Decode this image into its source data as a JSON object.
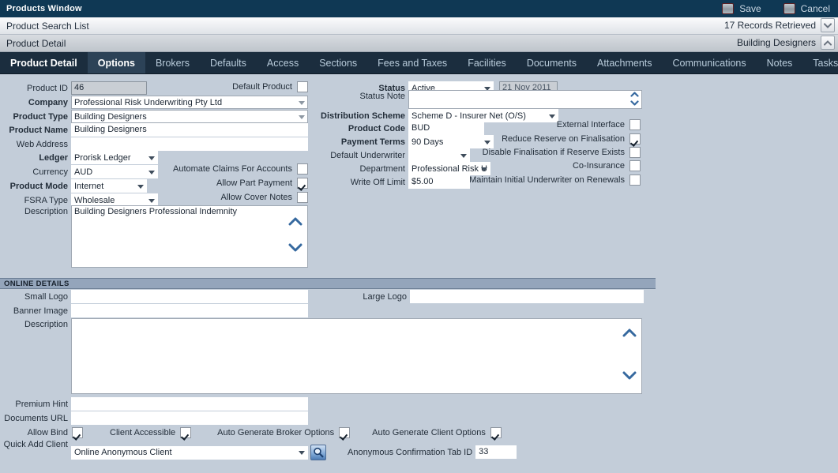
{
  "window": {
    "title": "Products Window",
    "actions": [
      {
        "name": "save",
        "label": "Save",
        "icon": "save-icon"
      },
      {
        "name": "cancel",
        "label": "Cancel",
        "icon": "cancel-icon"
      }
    ]
  },
  "search_bar": {
    "label": "Product Search List",
    "records_retrieved": "17 Records Retrieved",
    "collapse_icon": "chevron-down-icon"
  },
  "detail_bar": {
    "label": "Product Detail",
    "context": "Building Designers",
    "expand_icon": "chevron-up-icon"
  },
  "tabs": [
    {
      "label": "Product Detail",
      "state": "active"
    },
    {
      "label": "Options",
      "state": "current"
    },
    {
      "label": "Brokers",
      "state": "normal"
    },
    {
      "label": "Defaults",
      "state": "normal"
    },
    {
      "label": "Access",
      "state": "normal"
    },
    {
      "label": "Sections",
      "state": "normal"
    },
    {
      "label": "Fees and Taxes",
      "state": "normal"
    },
    {
      "label": "Facilities",
      "state": "normal"
    },
    {
      "label": "Documents",
      "state": "normal"
    },
    {
      "label": "Attachments",
      "state": "normal"
    },
    {
      "label": "Communications",
      "state": "normal"
    },
    {
      "label": "Notes",
      "state": "normal"
    },
    {
      "label": "Tasks",
      "state": "normal"
    }
  ],
  "product_detail": {
    "product_id": {
      "label": "Product ID",
      "value": "46"
    },
    "default_product": {
      "label": "Default Product",
      "checked": false
    },
    "company": {
      "label": "Company",
      "value": "Professional Risk Underwriting Pty Ltd"
    },
    "product_type": {
      "label": "Product Type",
      "value": "Building Designers"
    },
    "product_name": {
      "label": "Product Name",
      "value": "Building Designers"
    },
    "web_address": {
      "label": "Web Address",
      "value": ""
    },
    "ledger": {
      "label": "Ledger",
      "value": "Prorisk Ledger"
    },
    "currency": {
      "label": "Currency",
      "value": "AUD"
    },
    "product_mode": {
      "label": "Product Mode",
      "value": "Internet"
    },
    "fsra_type": {
      "label": "FSRA Type",
      "value": "Wholesale"
    },
    "description": {
      "label": "Description",
      "value": "Building Designers Professional Indemnity"
    },
    "automate_claims": {
      "label": "Automate Claims For Accounts",
      "checked": false
    },
    "allow_part_payment": {
      "label": "Allow Part Payment",
      "checked": true
    },
    "allow_cover_notes": {
      "label": "Allow Cover Notes",
      "checked": false
    },
    "status": {
      "label": "Status",
      "value": "Active"
    },
    "status_date": {
      "value": "21 Nov 2011"
    },
    "status_note": {
      "label": "Status Note",
      "value": ""
    },
    "distribution_scheme": {
      "label": "Distribution Scheme",
      "value": "Scheme D - Insurer Net (O/S)"
    },
    "product_code": {
      "label": "Product Code",
      "value": "BUD"
    },
    "payment_terms": {
      "label": "Payment Terms",
      "value": "90 Days"
    },
    "default_underwriter": {
      "label": "Default Underwriter",
      "value": ""
    },
    "department": {
      "label": "Department",
      "value": "Professional Risk U"
    },
    "write_off_limit": {
      "label": "Write Off Limit",
      "value": "$5.00"
    },
    "external_interface": {
      "label": "External Interface",
      "checked": false
    },
    "reduce_reserve": {
      "label": "Reduce Reserve on Finalisation",
      "checked": true
    },
    "disable_finalisation": {
      "label": "Disable Finalisation if Reserve Exists",
      "checked": false
    },
    "co_insurance": {
      "label": "Co-Insurance",
      "checked": false
    },
    "maintain_initial_underwriter": {
      "label": "Maintain Initial Underwriter on Renewals",
      "checked": false
    }
  },
  "online_details": {
    "header": "ONLINE DETAILS",
    "small_logo": {
      "label": "Small Logo",
      "value": ""
    },
    "large_logo": {
      "label": "Large Logo",
      "value": ""
    },
    "banner_image": {
      "label": "Banner Image",
      "value": ""
    },
    "description": {
      "label": "Description",
      "value": ""
    },
    "premium_hint": {
      "label": "Premium Hint",
      "value": ""
    },
    "documents_url": {
      "label": "Documents URL",
      "value": ""
    },
    "allow_bind": {
      "label": "Allow Bind",
      "checked": true
    },
    "client_accessible": {
      "label": "Client Accessible",
      "checked": true
    },
    "auto_generate_broker_options": {
      "label": "Auto Generate Broker Options",
      "checked": true
    },
    "auto_generate_client_options": {
      "label": "Auto Generate Client Options",
      "checked": true
    },
    "quick_add_client": {
      "label": "Quick Add Client",
      "value": "Online Anonymous Client",
      "search_icon": "magnifier-icon"
    },
    "anonymous_confirmation_tab_id": {
      "label": "Anonymous Confirmation Tab ID",
      "value": "33"
    }
  },
  "colors": {
    "titlebar": "#0f3854",
    "tabstrip": "#1b2d3e",
    "tab_current": "#2c4257",
    "form_bg": "#c3cdd9",
    "section_header": "#94a5bb",
    "chevron_blue": "#36699f"
  }
}
